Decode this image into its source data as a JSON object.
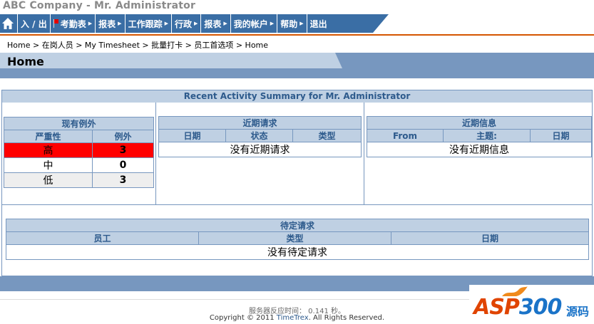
{
  "header": {
    "app_title": "ABC Company - Mr. Administrator"
  },
  "nav": {
    "home_icon": "home-icon",
    "items": [
      {
        "label": "入 / 出",
        "arrow": false,
        "flag": false
      },
      {
        "label": "考勤表",
        "arrow": true,
        "flag": true
      },
      {
        "label": "报表",
        "arrow": true,
        "flag": false
      },
      {
        "label": "工作跟踪",
        "arrow": true,
        "flag": false
      },
      {
        "label": "行政",
        "arrow": true,
        "flag": false
      },
      {
        "label": "报表",
        "arrow": true,
        "flag": false
      },
      {
        "label": "我的帐户",
        "arrow": true,
        "flag": false
      },
      {
        "label": "帮助",
        "arrow": true,
        "flag": false
      },
      {
        "label": "退出",
        "arrow": false,
        "flag": false
      }
    ],
    "arrow_glyph": "▶",
    "accent": "#3a6ea5"
  },
  "breadcrumb": {
    "items": [
      "Home",
      "在岗人员",
      "My Timesheet",
      "批量打卡",
      "员工首选项",
      "Home"
    ],
    "separator": ">"
  },
  "page": {
    "title": "Home"
  },
  "summary": {
    "heading": "Recent Activity Summary for Mr. Administrator",
    "exceptions": {
      "title": "现有例外",
      "columns": [
        "严重性",
        "例外"
      ],
      "rows": [
        {
          "severity": "高",
          "count": "3",
          "color": "#ff0000"
        },
        {
          "severity": "中",
          "count": "0",
          "color": "#ffffff"
        },
        {
          "severity": "低",
          "count": "3",
          "color": "#eeeeee"
        }
      ]
    },
    "requests": {
      "title": "近期请求",
      "columns": [
        "日期",
        "状态",
        "类型"
      ],
      "empty": "没有近期请求"
    },
    "messages": {
      "title": "近期信息",
      "columns": [
        "From",
        "主题:",
        "日期"
      ],
      "empty": "没有近期信息"
    },
    "pending": {
      "title": "待定请求",
      "columns": [
        "员工",
        "类型",
        "日期"
      ],
      "empty": "没有待定请求"
    }
  },
  "footer": {
    "response_time": "服务器反应时间： 0.141 秒。",
    "copyright_prefix": "Copyright © 2011 ",
    "copyright_link": "TimeTrex",
    "copyright_suffix": ". All Rights Reserved."
  },
  "watermark": {
    "brand_a": "ASP",
    "brand_b": "300",
    "brand_cn": "源码"
  }
}
